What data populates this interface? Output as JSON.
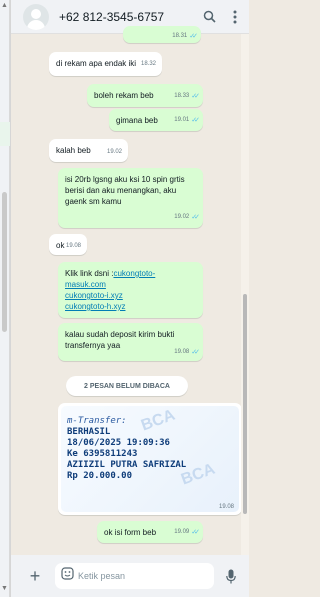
{
  "header": {
    "contact_name": "+62 812-3545-6757",
    "search_icon": "search-icon",
    "menu_icon": "kebab-menu-icon"
  },
  "messages": {
    "m0": {
      "time": "18.31"
    },
    "m1": {
      "text": "di rekam apa endak iki",
      "time": "18.32"
    },
    "m2": {
      "text": "boleh rekam beb",
      "time": "18.33"
    },
    "m3": {
      "text": "gimana beb",
      "time": "19.01"
    },
    "m4": {
      "text": "kalah beb",
      "time": "19.02"
    },
    "m5": {
      "text": "isi 20rb lgsng aku ksi 10 spin grtis berisi dan aku menangkan, aku gaenk sm kamu",
      "time": "19.02"
    },
    "m6": {
      "text": "ok",
      "time": "19.08"
    },
    "m7": {
      "prefix": "Klik link dsni :",
      "link1": "cukongtoto-masuk.com",
      "link2": "cukongtoto-i.xyz",
      "link3": "cukongtoto-h.xyz"
    },
    "m8": {
      "text": "kalau sudah deposit kirim bukti transfernya yaa",
      "time": "19.08"
    },
    "m9": {
      "time": "19.08"
    },
    "m10": {
      "text": "ok isi form beb",
      "time": "19.09"
    }
  },
  "unread_banner": "2 PESAN BELUM DIBACA",
  "receipt": {
    "line1": "m-Transfer:",
    "line2": "BERHASIL",
    "line3": "18/06/2025 19:09:36",
    "line4": "Ke 6395811243",
    "line5": "AZIIZIL PUTRA SAFRIZAL",
    "line6": "Rp 20.000.00",
    "watermark": "BCA"
  },
  "composer": {
    "placeholder": "Ketik pesan"
  },
  "colors": {
    "incoming": "#ffffff",
    "outgoing": "#d9fdd3",
    "chat_bg": "#efeae2",
    "read_ticks": "#53bdeb",
    "link": "#027eb5"
  }
}
